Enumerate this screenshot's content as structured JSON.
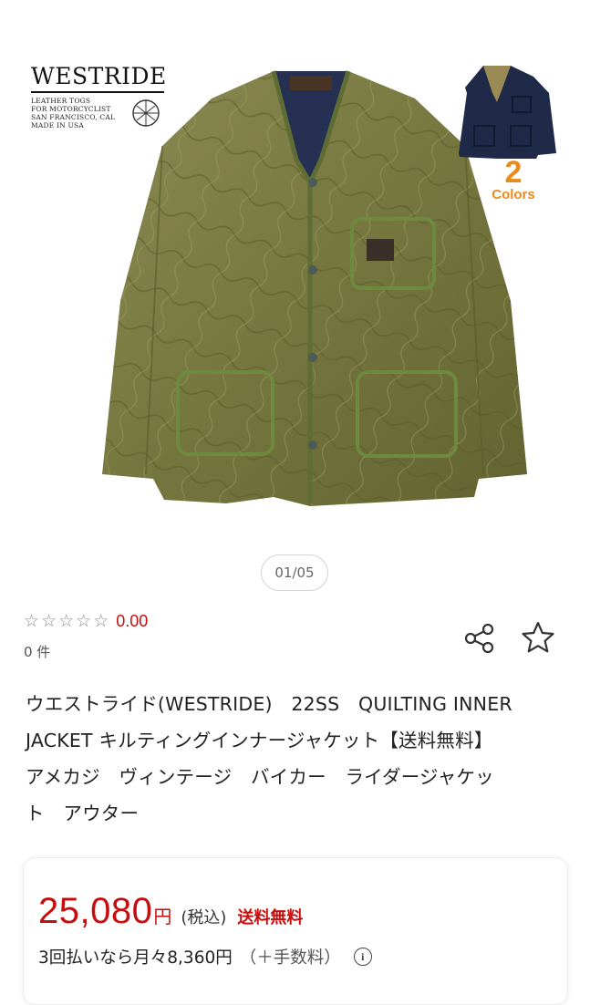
{
  "gallery": {
    "brand_logo": {
      "wordmark": "WESTRIDE",
      "tagline_1": "LEATHER TOGS",
      "tagline_2": "FOR MOTORCYCLIST",
      "tagline_3": "SAN FRANCISCO, CAL",
      "tagline_4": "MADE IN USA"
    },
    "colors_badge": {
      "number": "2",
      "text": "Colors"
    },
    "counter": "01/05",
    "main_jacket_color": "#7a7a45",
    "thumb_jacket_color": "#1e2a47"
  },
  "rating": {
    "stars_filled": 0,
    "stars_total": 5,
    "value": "0.00",
    "count": "0 件"
  },
  "actions": {
    "share_icon": "share-icon",
    "favorite_icon": "star-outline-icon"
  },
  "product": {
    "title_line_1": "ウエストライド(WESTRIDE)　22SS　QUILTING INNER",
    "title_line_2": "JACKET キルティングインナージャケット【送料無料】",
    "title_line_3": "アメカジ　ヴィンテージ　バイカー　ライダージャケッ",
    "title_line_4": "ト　アウター"
  },
  "pricing": {
    "price": "25,080",
    "currency": "円",
    "tax_note": "(税込)",
    "shipping": "送料無料",
    "installment": "3回払いなら月々8,360円",
    "fee_note": "（＋手数料）",
    "info_icon": "i",
    "accent_color": "#c70e0e"
  }
}
